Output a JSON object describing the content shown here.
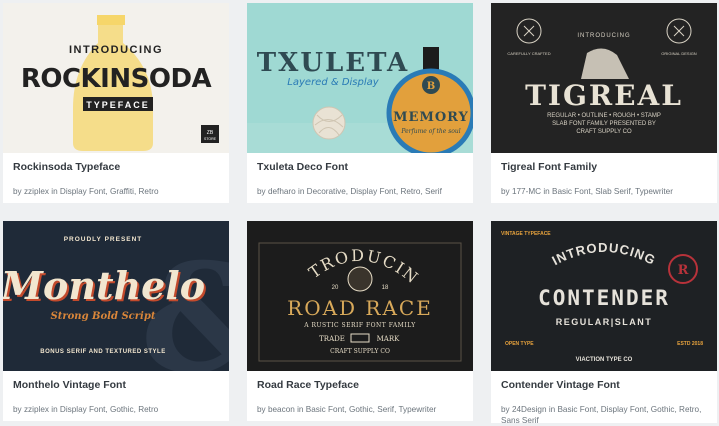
{
  "cards": [
    {
      "title": "Rockinsoda Typeface",
      "by": "by",
      "author": "zziplex",
      "in": "in",
      "cats": [
        "Display Font",
        "Graffiti",
        "Retro"
      ],
      "thumb": {
        "t1": "INTRODUCING",
        "t2": "ROCKINSODA",
        "t3": "TYPEFACE",
        "t4": "ZB",
        "t5": "STORE",
        "bg": "#f3f1ec"
      }
    },
    {
      "title": "Txuleta Deco Font",
      "by": "by",
      "author": "defharo",
      "in": "in",
      "cats": [
        "Decorative",
        "Display Font",
        "Retro",
        "Serif"
      ],
      "thumb": {
        "t1": "TXULETA",
        "t2": "Layered & Display",
        "t3": "MEMORY",
        "t4": "Perfume of the soul",
        "t5": "B",
        "bg": "#9fd9d3"
      }
    },
    {
      "title": "Tigreal Font Family",
      "by": "by",
      "author": "177-MC",
      "in": "in",
      "cats": [
        "Basic Font",
        "Slab Serif",
        "Typewriter"
      ],
      "thumb": {
        "t1": "INTRODUCING",
        "t2": "TIGREAL",
        "t3": "REGULAR • OUTLINE • ROUGH • STAMP",
        "t4": "SLAB FONT FAMILY PRESENTED BY",
        "t5": "CRAFT SUPPLY CO",
        "t6": "CAREFULLY CRAFTED",
        "t7": "ORIGINAL DESIGN",
        "bg": "#232323"
      }
    },
    {
      "title": "Monthelo Vintage Font",
      "by": "by",
      "author": "zziplex",
      "in": "in",
      "cats": [
        "Display Font",
        "Gothic",
        "Retro"
      ],
      "thumb": {
        "t1": "PROUDLY PRESENT",
        "t2": "Monthelo",
        "t3": "Strong Bold Script",
        "t4": "BONUS SERIF AND TEXTURED STYLE",
        "bg": "#1f2a38"
      }
    },
    {
      "title": "Road Race Typeface",
      "by": "by",
      "author": "beacon",
      "in": "in",
      "cats": [
        "Basic Font",
        "Gothic",
        "Serif",
        "Typewriter"
      ],
      "thumb": {
        "t1": "INTRODUCING",
        "t2": "ROAD RACE",
        "t3": "A RUSTIC SERIF FONT FAMILY",
        "t4": "TRADE",
        "t5": "MARK",
        "t6": "CRAFT SUPPLY CO",
        "t7": "20",
        "t8": "18",
        "bg": "#1c1c1c"
      }
    },
    {
      "title": "Contender Vintage Font",
      "by": "by",
      "author": "24Design",
      "in": "in",
      "cats": [
        "Basic Font",
        "Display Font",
        "Gothic",
        "Retro",
        "Sans Serif"
      ],
      "thumb": {
        "t1": "INTRODUCING",
        "t2": "CONTENDER",
        "t3": "REGULAR|SLANT",
        "t4": "VINTAGE TYPEFACE",
        "t5": "OPEN TYPE",
        "t6": "ESTD 2018",
        "t7": "VIACTION TYPE CO",
        "t8": "R",
        "bg": "#1e2124"
      }
    }
  ],
  "colors": {
    "accent": "#e8a33d",
    "text": "#343a40",
    "muted": "#6c757d"
  }
}
